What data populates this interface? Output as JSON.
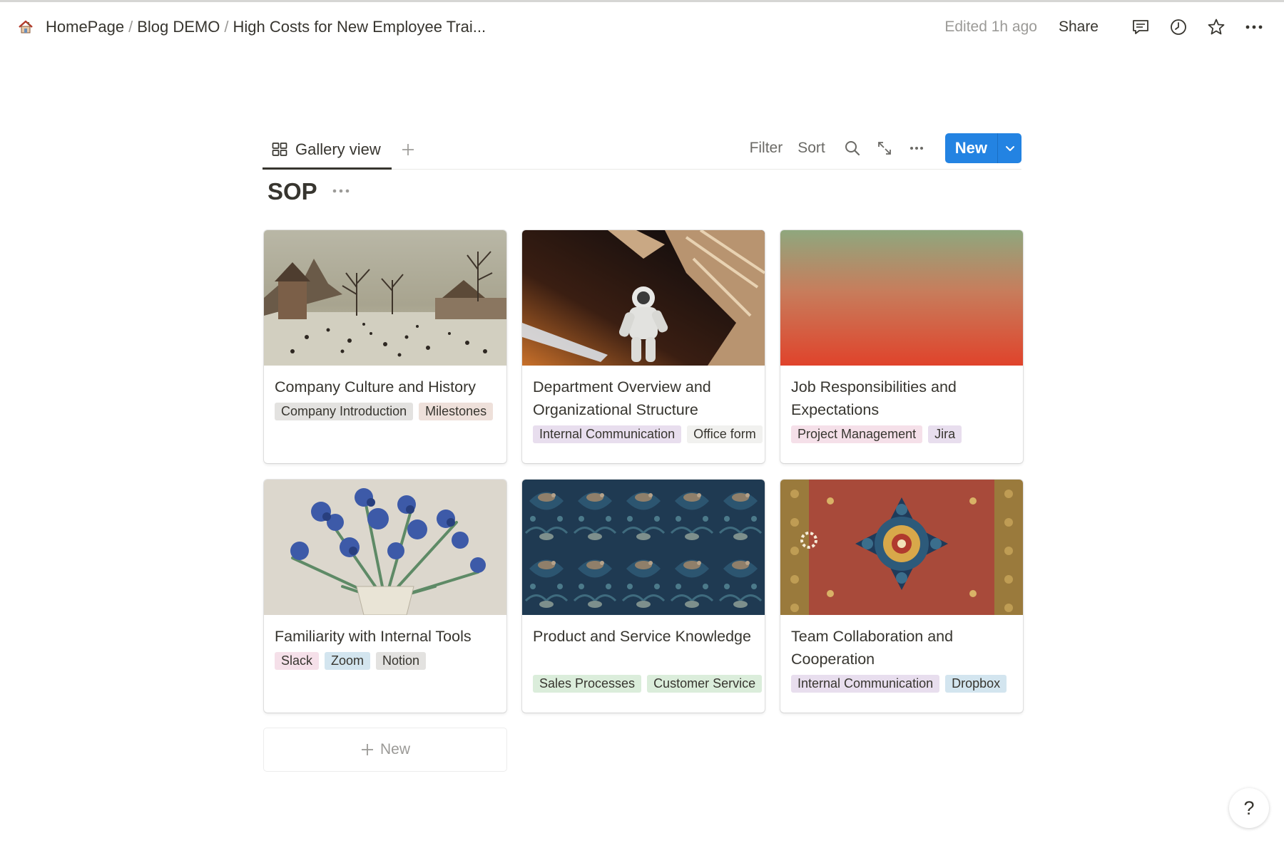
{
  "breadcrumb": {
    "items": [
      "HomePage",
      "Blog DEMO",
      "High Costs for New Employee Trai..."
    ],
    "separator": "/"
  },
  "topbar": {
    "edited": "Edited 1h ago",
    "share": "Share"
  },
  "view": {
    "tab_label": "Gallery view",
    "filter": "Filter",
    "sort": "Sort",
    "new_label": "New"
  },
  "database": {
    "title": "SOP"
  },
  "cards": [
    {
      "title": "Company Culture and History",
      "tags": [
        {
          "label": "Company Introduction",
          "color": "#e3e2e0"
        },
        {
          "label": "Milestones",
          "color": "#eee0da"
        }
      ]
    },
    {
      "title": "Department Overview and Organizational Structure",
      "tags": [
        {
          "label": "Internal Communication",
          "color": "#e8deee"
        },
        {
          "label": "Office form",
          "color": "#f1f1ef"
        }
      ]
    },
    {
      "title": "Job Responsibilities and Expectations",
      "tags": [
        {
          "label": "Project Management",
          "color": "#f5e0e9"
        },
        {
          "label": "Jira",
          "color": "#e8deee"
        }
      ]
    },
    {
      "title": "Familiarity with Internal Tools",
      "tags": [
        {
          "label": "Slack",
          "color": "#f5e0e9"
        },
        {
          "label": "Zoom",
          "color": "#d3e5ef"
        },
        {
          "label": "Notion",
          "color": "#e3e2e0"
        }
      ]
    },
    {
      "title": "Product and Service Knowledge",
      "tags": [
        {
          "label": "Sales Processes",
          "color": "#dbeddb"
        },
        {
          "label": "Customer Service",
          "color": "#dbeddb"
        }
      ]
    },
    {
      "title": "Team Collaboration and Cooperation",
      "tags": [
        {
          "label": "Internal Communication",
          "color": "#e8deee"
        },
        {
          "label": "Dropbox",
          "color": "#d3e5ef"
        }
      ]
    }
  ],
  "add_card_label": "New",
  "help_label": "?",
  "colors": {
    "accent": "#2383e2",
    "text": "#37352f",
    "muted": "#9b9a97"
  }
}
